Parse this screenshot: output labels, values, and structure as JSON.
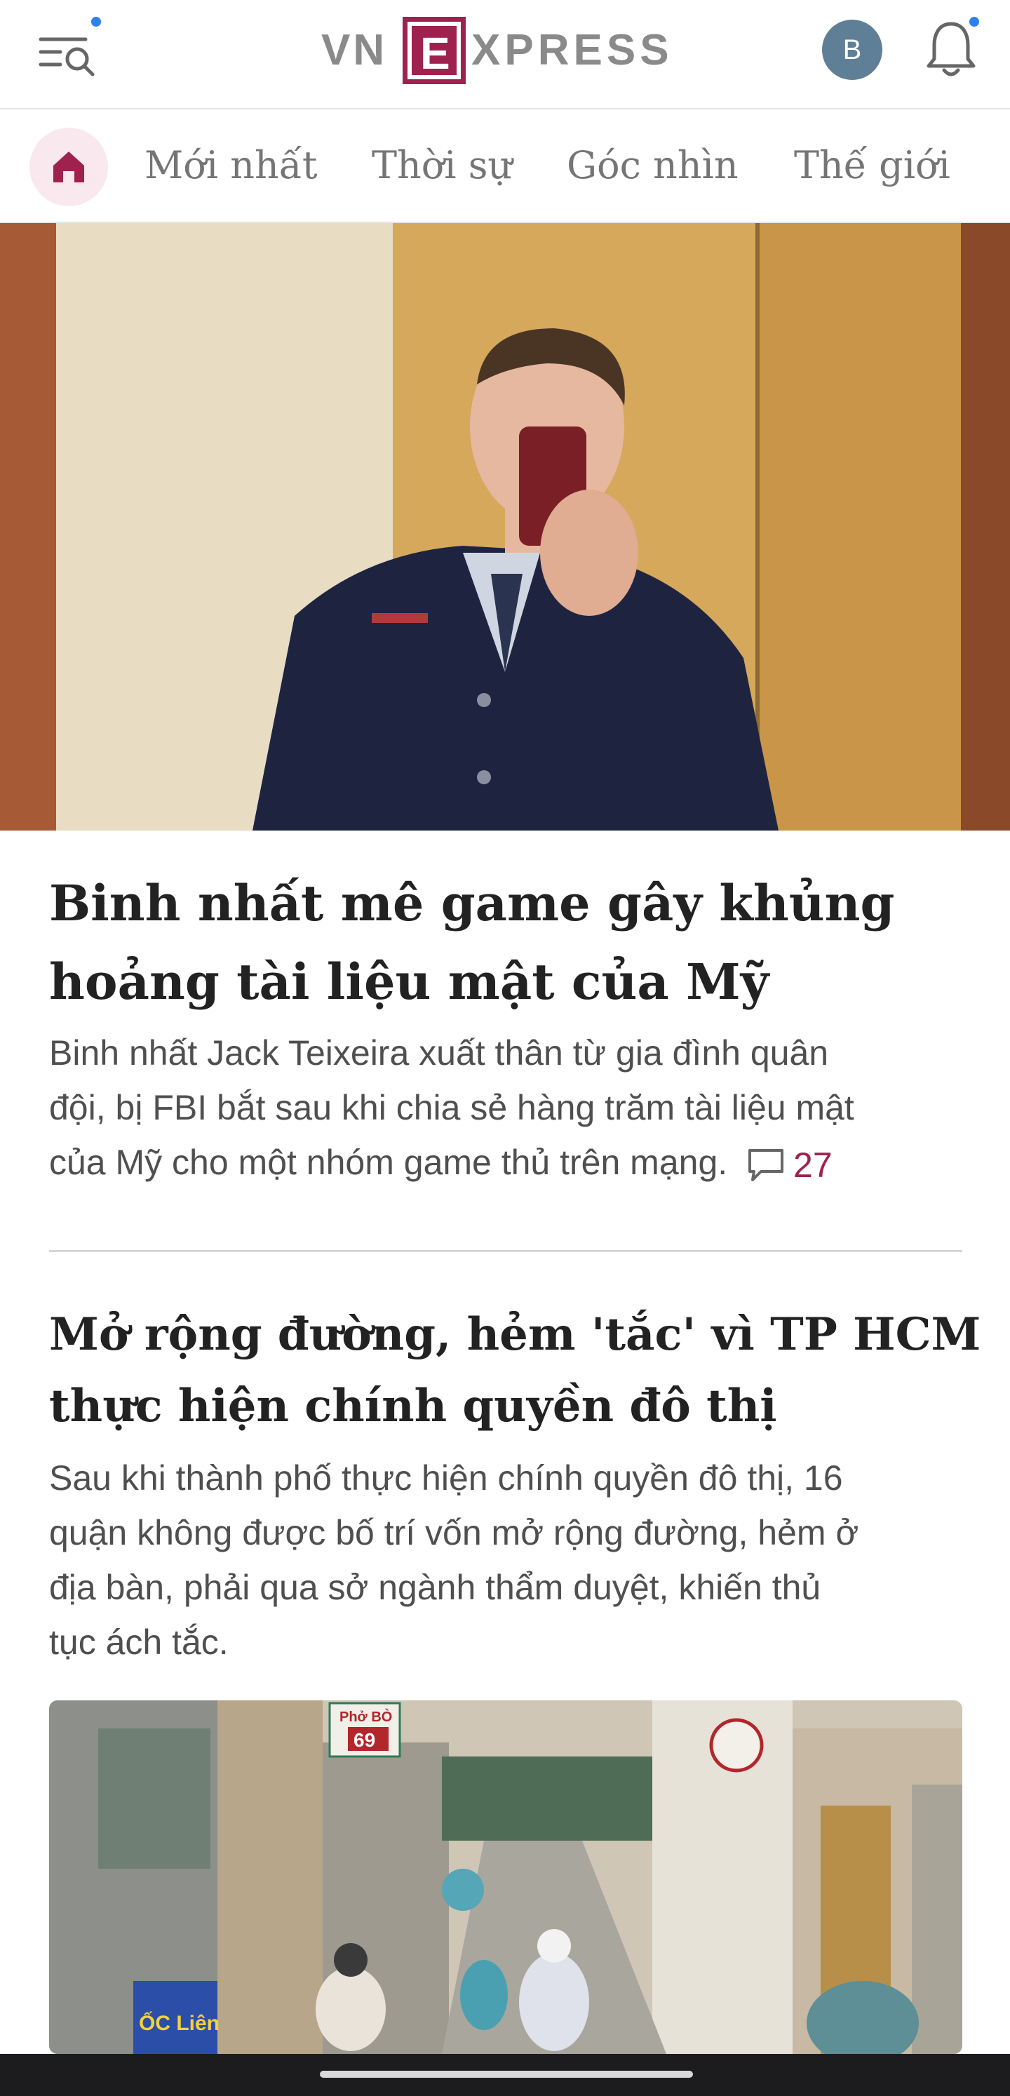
{
  "app": {
    "name": "VnExpress"
  },
  "header": {
    "logo_text": "VNEXPRESS",
    "avatar_initial": "B",
    "brand_color": "#9f224e",
    "notification_dot_color": "#2f80ed",
    "menu_icon": "menu-search-icon",
    "bell_icon": "bell-icon"
  },
  "nav": {
    "home_icon": "home-icon",
    "items": [
      {
        "label": "Mới nhất"
      },
      {
        "label": "Thời sự"
      },
      {
        "label": "Góc nhìn"
      },
      {
        "label": "Thế giới"
      }
    ]
  },
  "articles": [
    {
      "title_line1": "Binh nhất mê game gây khủng",
      "title_line2": "hoảng tài liệu mật của Mỹ",
      "desc_line1": "Binh nhất Jack Teixeira xuất thân từ gia đình quân",
      "desc_line2": "đội, bị FBI bắt sau khi chia sẻ hàng trăm tài liệu mật",
      "desc_line3": "của Mỹ cho một nhóm game thủ trên mạng.",
      "comment_count": "27",
      "image": "photo-soldier-selfie"
    },
    {
      "title_line1": "Mở rộng đường, hẻm 'tắc' vì TP HCM",
      "title_line2": "thực hiện chính quyền đô thị",
      "desc_line1": "Sau khi thành phố thực hiện chính quyền đô thị, 16",
      "desc_line2": "quận không được bố trí vốn mở rộng đường, hẻm ở",
      "desc_line3": "địa bàn, phải qua sở ngành thẩm duyệt, khiến thủ",
      "desc_line4": "tục ách tắc.",
      "image": "photo-alley-street",
      "signs": {
        "sign1": "Phở BÒ",
        "sign2": "69",
        "sign3": "ỐC Liên"
      }
    }
  ]
}
